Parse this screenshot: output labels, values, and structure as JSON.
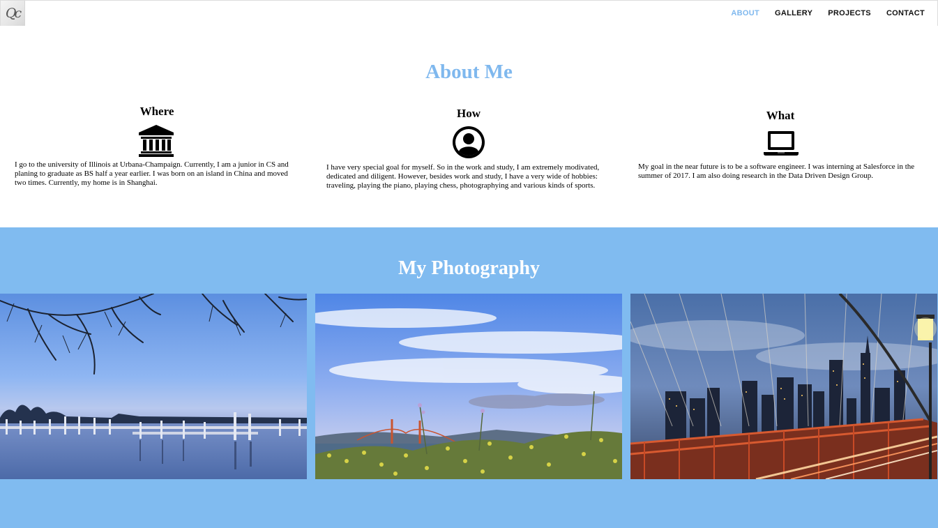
{
  "navbar": {
    "logo_text": "Qc",
    "items": [
      {
        "label": "ABOUT",
        "active": true
      },
      {
        "label": "GALLERY",
        "active": false
      },
      {
        "label": "PROJECTS",
        "active": false
      },
      {
        "label": "CONTACT",
        "active": false
      }
    ]
  },
  "about": {
    "title": "About Me",
    "columns": [
      {
        "heading": "Where",
        "icon": "university-icon",
        "text": "I go to the university of Illinois at Urbana-Champaign. Currently, I am a junior in CS and planing to graduate as BS half a year earlier. I was born on an island in China and moved two times. Currently, my home is in Shanghai."
      },
      {
        "heading": "How",
        "icon": "user-circle-icon",
        "text": "I have very special goal for myself. So in the work and study, I am extremely modivated, dedicated and diligent. However, besides work and study, I have a very wide of hobbies: traveling, playing the piano, playing chess, photographying and various kinds of sports."
      },
      {
        "heading": "What",
        "icon": "laptop-icon",
        "text": "My goal in the near future is to be a software engineer. I was interning at Salesforce in the summer of 2017. I am also doing research in the Data Driven Design Group."
      }
    ]
  },
  "photography": {
    "title": "My Photography",
    "photos": [
      {
        "subject": "lake-pier-at-dusk"
      },
      {
        "subject": "golden-gate-bridge-with-wildflowers"
      },
      {
        "subject": "brooklyn-bridge-city-skyline"
      }
    ]
  },
  "colors": {
    "accent": "#7fb8ee",
    "section_background": "#80bbf0",
    "text": "#000000"
  }
}
